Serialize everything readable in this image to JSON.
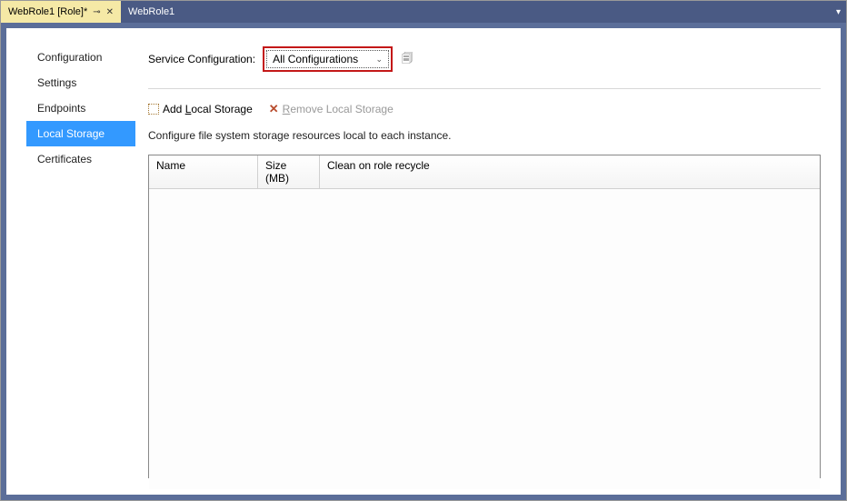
{
  "tabs": [
    {
      "label": "WebRole1 [Role]*",
      "active": true
    },
    {
      "label": "WebRole1",
      "active": false
    }
  ],
  "sidebar": {
    "items": [
      {
        "label": "Configuration"
      },
      {
        "label": "Settings"
      },
      {
        "label": "Endpoints"
      },
      {
        "label": "Local Storage"
      },
      {
        "label": "Certificates"
      }
    ],
    "selected_index": 3
  },
  "service_config": {
    "label": "Service Configuration:",
    "value": "All Configurations"
  },
  "actions": {
    "add_prefix": "Add ",
    "add_underline": "L",
    "add_suffix": "ocal Storage",
    "remove_prefix": "",
    "remove_underline": "R",
    "remove_suffix": "emove Local Storage"
  },
  "description": "Configure file system storage resources local to each instance.",
  "grid": {
    "columns": [
      {
        "label": "Name"
      },
      {
        "label": "Size (MB)"
      },
      {
        "label": "Clean on role recycle"
      }
    ]
  }
}
